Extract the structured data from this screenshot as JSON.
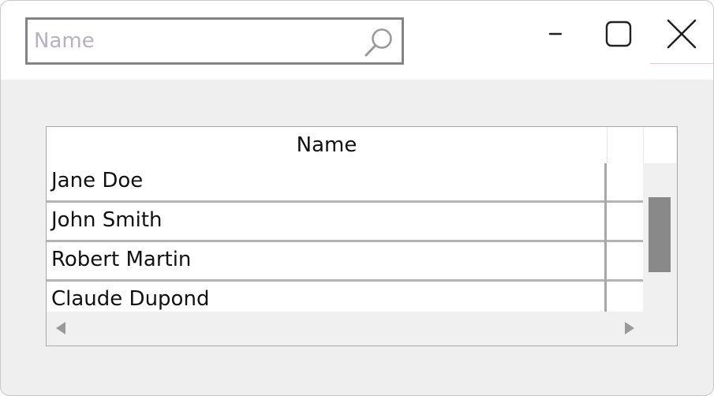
{
  "search": {
    "placeholder": "Name",
    "value": "",
    "icon": "search-icon"
  },
  "window_controls": {
    "minimize_icon": "minimize-icon",
    "maximize_icon": "maximize-icon",
    "close_icon": "close-icon"
  },
  "grid": {
    "columns": [
      "Name"
    ],
    "rows": [
      {
        "name": "Jane Doe"
      },
      {
        "name": "John Smith"
      },
      {
        "name": "Robert Martin"
      },
      {
        "name": "Claude Dupond"
      }
    ]
  },
  "colors": {
    "window_bg": "#efefef",
    "titlebar_bg": "#ffffff",
    "search_border": "#848484",
    "placeholder": "#b8b0c4",
    "scroll_thumb": "#898989",
    "row_separator": "#b4b4b4"
  }
}
